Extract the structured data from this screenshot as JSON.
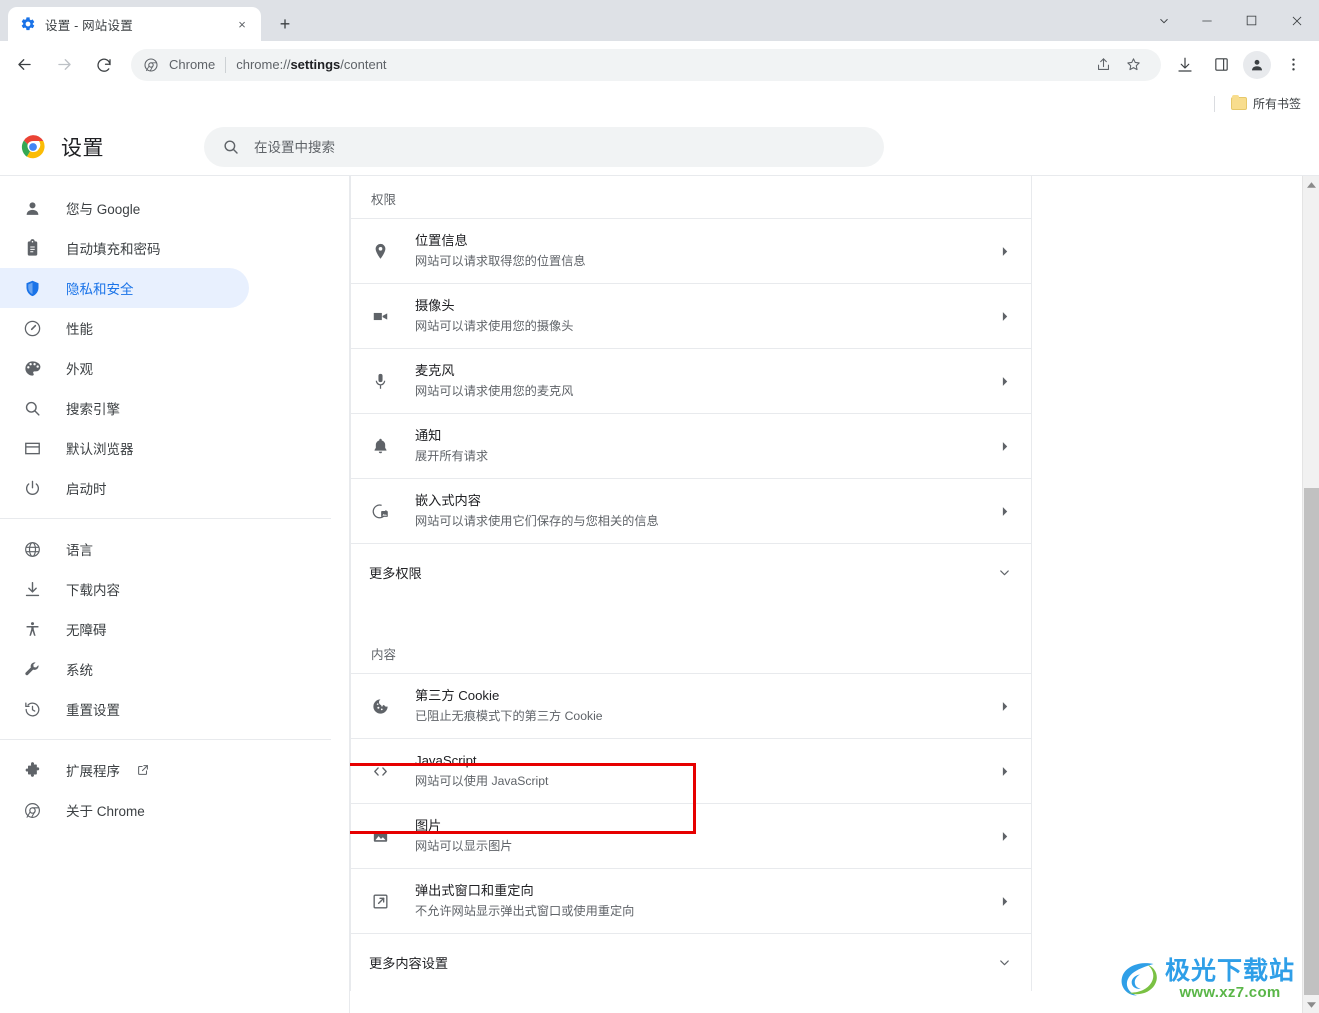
{
  "window": {
    "tab": {
      "title": "设置 - 网站设置",
      "favicon": "settings-gear-icon",
      "close": "×"
    },
    "new_tab_label": "+",
    "controls": {
      "tab_search": "tab-search-chevron",
      "minimize": "—",
      "maximize": "□",
      "close": "✕"
    }
  },
  "toolbar": {
    "back": "back-arrow-icon",
    "forward": "forward-arrow-icon",
    "reload": "reload-icon",
    "omnibox": {
      "site_icon": "chrome-security-icon",
      "site_label": "Chrome",
      "url_prefix": "chrome://",
      "url_bold": "settings",
      "url_suffix": "/content"
    },
    "share_icon": "share-icon",
    "bookmark_icon": "star-icon",
    "download_icon": "download-icon",
    "sidepanel_icon": "side-panel-icon",
    "profile_icon": "profile-avatar-icon",
    "menu_icon": "three-dot-menu-icon"
  },
  "bookmark_bar": {
    "all_bookmarks_label": "所有书签",
    "folder_icon": "folder-icon"
  },
  "settings_header": {
    "logo": "chrome-logo",
    "title": "设置",
    "search_placeholder": "在设置中搜索",
    "search_value": "",
    "search_icon": "search-icon"
  },
  "sidebar": {
    "groups": [
      {
        "items": [
          {
            "label": "您与 Google",
            "icon": "person-icon",
            "active": false
          },
          {
            "label": "自动填充和密码",
            "icon": "clipboard-icon",
            "active": false
          },
          {
            "label": "隐私和安全",
            "icon": "shield-icon",
            "active": true
          },
          {
            "label": "性能",
            "icon": "speedometer-icon",
            "active": false
          },
          {
            "label": "外观",
            "icon": "palette-icon",
            "active": false
          },
          {
            "label": "搜索引擎",
            "icon": "magnifier-icon",
            "active": false
          },
          {
            "label": "默认浏览器",
            "icon": "browser-window-icon",
            "active": false
          },
          {
            "label": "启动时",
            "icon": "power-icon",
            "active": false
          }
        ]
      },
      {
        "items": [
          {
            "label": "语言",
            "icon": "globe-icon",
            "active": false
          },
          {
            "label": "下载内容",
            "icon": "download-icon",
            "active": false
          },
          {
            "label": "无障碍",
            "icon": "accessibility-icon",
            "active": false
          },
          {
            "label": "系统",
            "icon": "wrench-icon",
            "active": false
          },
          {
            "label": "重置设置",
            "icon": "history-restore-icon",
            "active": false
          }
        ]
      },
      {
        "items": [
          {
            "label": "扩展程序",
            "icon": "puzzle-icon",
            "active": false,
            "external": true
          },
          {
            "label": "关于 Chrome",
            "icon": "chrome-icon",
            "active": false
          }
        ]
      }
    ]
  },
  "content": {
    "permissions_label": "权限",
    "permissions": [
      {
        "title": "位置信息",
        "sub": "网站可以请求取得您的位置信息",
        "icon": "location-pin-icon"
      },
      {
        "title": "摄像头",
        "sub": "网站可以请求使用您的摄像头",
        "icon": "camera-icon"
      },
      {
        "title": "麦克风",
        "sub": "网站可以请求使用您的麦克风",
        "icon": "microphone-icon"
      },
      {
        "title": "通知",
        "sub": "展开所有请求",
        "icon": "bell-icon"
      },
      {
        "title": "嵌入式内容",
        "sub": "网站可以请求使用它们保存的与您相关的信息",
        "icon": "embedded-content-icon"
      }
    ],
    "more_permissions_label": "更多权限",
    "content_label": "内容",
    "content_items": [
      {
        "title": "第三方 Cookie",
        "sub": "已阻止无痕模式下的第三方 Cookie",
        "icon": "cookie-icon",
        "highlighted": false
      },
      {
        "title": "JavaScript",
        "sub": "网站可以使用 JavaScript",
        "icon": "code-brackets-icon",
        "highlighted": false
      },
      {
        "title": "图片",
        "sub": "网站可以显示图片",
        "icon": "image-icon",
        "highlighted": true
      },
      {
        "title": "弹出式窗口和重定向",
        "sub": "不允许网站显示弹出式窗口或使用重定向",
        "icon": "popup-redirect-icon",
        "highlighted": false
      }
    ],
    "more_content_settings_label": "更多内容设置"
  },
  "watermark": {
    "title": "极光下载站",
    "url": "www.xz7.com"
  },
  "colors": {
    "accent_blue": "#1a73e8",
    "active_pill": "#e8f0fe",
    "highlight_red": "#e60000",
    "text_primary": "#202124",
    "text_secondary": "#5f6368",
    "chrome_frame": "#dee1e6"
  }
}
